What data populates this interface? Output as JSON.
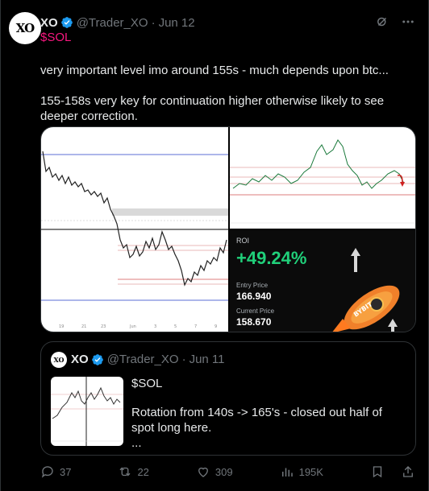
{
  "tweet": {
    "avatar_text": "XO",
    "name": "XO",
    "handle": "@Trader_XO",
    "separator": "·",
    "date": "Jun 12",
    "ticker": "$SOL",
    "paragraphs": [
      "very important level imo around 155s - much depends upon btc...",
      "155-158s very key for continuation higher otherwise likely to see deeper correction."
    ]
  },
  "media": {
    "roi_label": "ROI",
    "roi_value": "+49.24%",
    "entry_label": "Entry Price",
    "entry_value": "166.940",
    "current_label": "Current Price",
    "current_value": "158.670",
    "brand": "BYBIT"
  },
  "quote": {
    "avatar_text": "XO",
    "name": "XO",
    "handle": "@Trader_XO",
    "separator": "·",
    "date": "Jun 11",
    "lines": [
      "$SOL",
      "Rotation from 140s -> 165's - closed out half of spot long here.",
      "..."
    ]
  },
  "actions": {
    "replies": "37",
    "reposts": "22",
    "likes": "309",
    "views": "195K"
  },
  "colors": {
    "background": "#000000",
    "text": "#e7e9ea",
    "muted": "#71767b",
    "cashtag": "#f91880",
    "verified": "#1d9bf0",
    "roi_green": "#20d07a"
  }
}
